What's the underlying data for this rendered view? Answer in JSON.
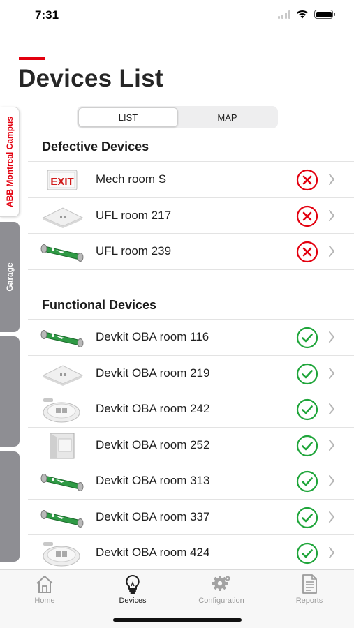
{
  "status_bar": {
    "time": "7:31"
  },
  "header": {
    "title": "Devices List",
    "accent_color": "#e3000f"
  },
  "side_tabs": [
    {
      "label": "ABB Montreal Campus",
      "active": true
    },
    {
      "label": "Garage",
      "active": false
    },
    {
      "label": "",
      "active": false
    },
    {
      "label": "",
      "active": false
    }
  ],
  "view_toggle": {
    "options": [
      "LIST",
      "MAP"
    ],
    "selected": "LIST"
  },
  "defective": {
    "title": "Defective Devices",
    "items": [
      {
        "name": "Mech room S",
        "device_type": "exit-sign",
        "status": "error"
      },
      {
        "name": "UFL room 217",
        "device_type": "square-light",
        "status": "error"
      },
      {
        "name": "UFL room 239",
        "device_type": "tube-sign",
        "status": "error"
      }
    ]
  },
  "functional": {
    "title": "Functional Devices",
    "items": [
      {
        "name": "Devkit OBA room 116",
        "device_type": "tube-sign",
        "status": "ok"
      },
      {
        "name": "Devkit OBA room 219",
        "device_type": "square-light",
        "status": "ok"
      },
      {
        "name": "Devkit OBA room 242",
        "device_type": "round-light",
        "status": "ok"
      },
      {
        "name": "Devkit OBA room 252",
        "device_type": "box-light",
        "status": "ok"
      },
      {
        "name": "Devkit OBA room 313",
        "device_type": "tube-sign",
        "status": "ok"
      },
      {
        "name": "Devkit OBA room 337",
        "device_type": "tube-sign",
        "status": "ok"
      },
      {
        "name": "Devkit OBA room 424",
        "device_type": "round-light",
        "status": "ok"
      }
    ]
  },
  "colors": {
    "error": "#e3000f",
    "ok": "#1fa53a",
    "chevron": "#b5b5b5"
  },
  "tab_bar": {
    "items": [
      {
        "label": "Home",
        "icon": "home-icon",
        "active": false
      },
      {
        "label": "Devices",
        "icon": "lightbulb-icon",
        "active": true
      },
      {
        "label": "Configuration",
        "icon": "gear-icon",
        "active": false
      },
      {
        "label": "Reports",
        "icon": "document-icon",
        "active": false
      }
    ]
  }
}
